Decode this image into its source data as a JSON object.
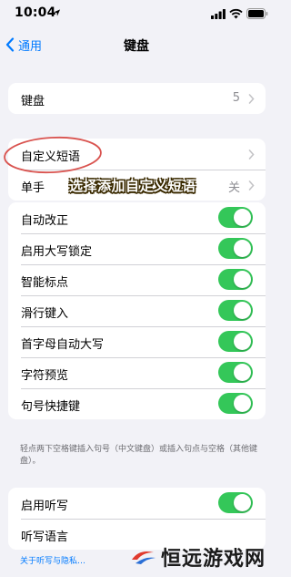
{
  "status": {
    "time": "10:04"
  },
  "nav": {
    "back_label": "通用",
    "title": "键盘"
  },
  "group1": {
    "label": "键盘",
    "value": "5"
  },
  "group2": {
    "items": [
      {
        "label": "自定义短语",
        "value": ""
      },
      {
        "label": "单手",
        "value": "关"
      }
    ]
  },
  "caption": "选择添加自定义短语",
  "toggles": {
    "items": [
      {
        "label": "自动改正",
        "on": true
      },
      {
        "label": "启用大写锁定",
        "on": true
      },
      {
        "label": "智能标点",
        "on": true
      },
      {
        "label": "滑行键入",
        "on": true
      },
      {
        "label": "首字母自动大写",
        "on": true
      },
      {
        "label": "字符预览",
        "on": true
      },
      {
        "label": "句号快捷键",
        "on": true
      }
    ]
  },
  "footnote": "轻点两下空格键插入句号（中文键盘）或插入句点与空格（其他键盘）。",
  "dictation": {
    "items": [
      {
        "label": "启用听写",
        "on": true
      },
      {
        "label": "听写语言"
      }
    ]
  },
  "bottom_link": "关于听写与隐私…",
  "watermark": "恒远游戏网",
  "colors": {
    "accent": "#007aff",
    "toggle_on": "#34c759",
    "annotation": "#d9534f"
  }
}
